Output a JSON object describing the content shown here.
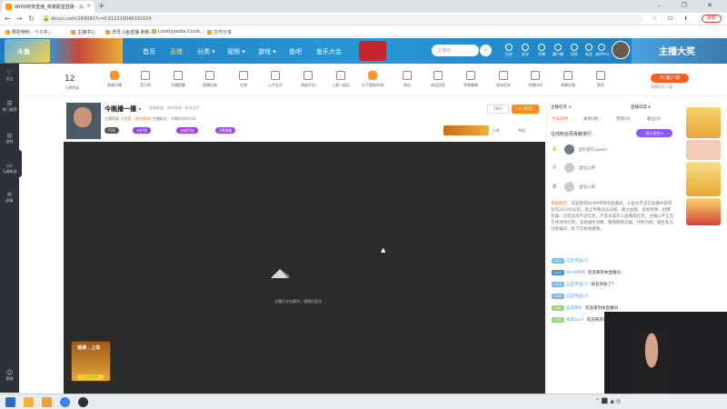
{
  "browser": {
    "tab_title": "Wr99突突直播_英雄联盟直播 - 斗...",
    "tab_close": "×",
    "new_tab": "+",
    "window_controls": "– ❐ ✕",
    "url": "douyu.com/169092?c=0.512116046191024",
    "nav_right_icons": "☆ ⊡ ⬇",
    "profile_button": "更新"
  },
  "bookmarks": [
    "那些特料 · 个人中...",
    "主播中心",
    "虎牙斗鱼直播 刷新...",
    "Lonelypedia Coule...",
    "文件分享"
  ],
  "site_header": {
    "logo": "斗鱼",
    "nav": [
      "首页",
      "直播",
      "分类 ▾",
      "视频 ▾",
      "游戏 ▾",
      "鱼吧",
      "鱼乐大会"
    ],
    "active_nav": "直播",
    "search_placeholder": "主播名",
    "search_icon": "⌕",
    "icons": [
      "历史",
      "关注",
      "开播",
      "客户端",
      "消息",
      "私信",
      "创作中心"
    ],
    "banner_text": "主播大奖"
  },
  "left_sidebar": {
    "items": [
      {
        "icon": "♡",
        "label": "关注"
      },
      {
        "icon": "☰",
        "label": "热门推荐"
      },
      {
        "icon": "◎",
        "label": "游戏"
      },
      {
        "icon": "▭",
        "label": "王者新游"
      },
      {
        "icon": "♔",
        "label": "赛事"
      },
      {
        "icon": "☺",
        "label": "客服"
      }
    ]
  },
  "toolbar": {
    "level_value": "12",
    "level_label": "主播等级",
    "items": [
      "直播开播",
      "音乐榜",
      "开播提醒",
      "直播设备",
      "礼物",
      "火力全开",
      "贵族开启",
      "上麦一起玩",
      "水下版权申请",
      "商店",
      "欢迎回家",
      "荣誉徽章",
      "发布信息",
      "开播时间",
      "弹幕礼物",
      "更多"
    ],
    "client_button": "PC客户端",
    "client_sub": "直播伴侣下载"
  },
  "room": {
    "title": "今晚播一播 -",
    "category": "英雄联盟 · 单机游戏 · 职业选手",
    "meta_prefix": "主播等级 ",
    "meta_highlight": "斗鱼第 · 排名第6名 ",
    "meta_suffix": "主播粉丝 · 开播时间16:00",
    "badges": [
      "汽车",
      "守护团",
      "达成目标",
      "VIP高级"
    ],
    "follow_count": "5847",
    "follow_label": "+ 关注",
    "share": "分享",
    "report": "举报"
  },
  "video": {
    "loading_text": "主播正在加载中，请稍后尝试",
    "gift_title": "速通 . 上车",
    "gift_button": "上车领奖"
  },
  "right_panel": {
    "tabs_top": [
      "主播任务 >",
      "直播日常 ▾"
    ],
    "tabs": [
      "今日日榜",
      "本周(周)",
      "贵宾(0)",
      "粉丝(0)"
    ],
    "rank_title": "在线粉丝周贡献排行",
    "rank_button": "成为贵宾 ▸",
    "ranks": [
      "虎扑虾仁qwert",
      "虚位以待",
      "虚位以待"
    ],
    "notice_label": "系统提示：",
    "notice_text": "欢迎来到Wr99突突的直播间，斗鱼也无法在直播中获得任何24小时返现，禁止传播违法违规、暴力血腥、低俗色情、招嫖诈骗、违禁品等不良信息，严禁未成年人直播或打赏，主播以不正当方式诱导打赏，注意理性消费，警惕网络诈骗，代练代刷、陌生私信均系骗局，私下交易请谨慎。",
    "messages": [
      {
        "level": "LV20",
        "user": "这是帝国(7)",
        "text": ""
      },
      {
        "level": "LV11",
        "user": "Wr99突突",
        "text": "欢迎来到本直播间"
      },
      {
        "level": "LV20",
        "user": "这是帝国(7)",
        "text": "排名到站了？"
      },
      {
        "level": "LV20",
        "user": "这是帝国(7)",
        "text": ""
      },
      {
        "level": "LV1",
        "user": "鱼友精彩",
        "text": "欢迎来到本直播间"
      },
      {
        "level": "LV3",
        "user": "网友dxz7",
        "text": "欢迎来到本直播间"
      }
    ]
  },
  "webcam": {
    "label": ""
  },
  "taskbar": {
    "tray": "^ ⬛ ▲ ◎"
  }
}
